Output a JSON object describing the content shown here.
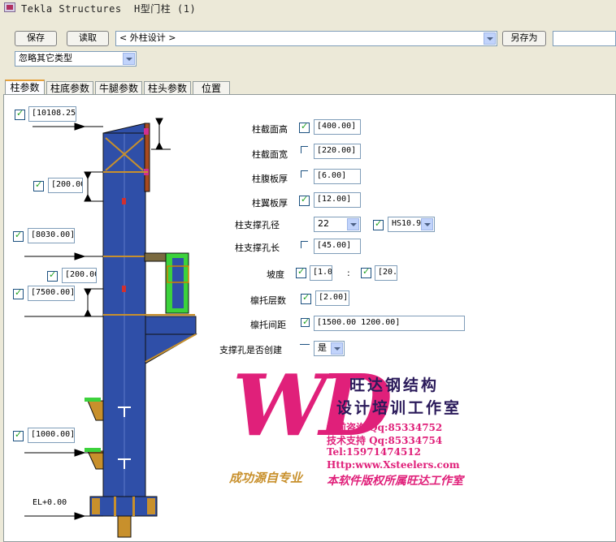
{
  "window": {
    "title": "Tekla Structures  H型门柱 (1)"
  },
  "toolbar": {
    "save_label": "保存",
    "load_label": "读取",
    "preset_value": "< 外柱设计 >",
    "saveas_label": "另存为",
    "saveas_value": "",
    "filter_value": "忽略其它类型"
  },
  "tabs": [
    "柱参数",
    "柱底参数",
    "牛腿参数",
    "柱头参数",
    "位置"
  ],
  "drawing": {
    "dim_top": "[10108.25",
    "dim_2": "[200.00",
    "dim_3": "[8030.00]",
    "dim_4": "[200.00",
    "dim_5": "[7500.00]",
    "dim_6": "[1000.00]",
    "elevation": "EL+0.00"
  },
  "params": {
    "section_height": {
      "label": "柱截面高",
      "value": "[400.00]",
      "checked": true
    },
    "section_width": {
      "label": "柱截面宽",
      "value": "[220.00]",
      "checked": false
    },
    "web_thickness": {
      "label": "柱腹板厚",
      "value": "[6.00]",
      "checked": false
    },
    "flange_thickness": {
      "label": "柱翼板厚",
      "value": "[12.00]",
      "checked": true
    },
    "brace_hole_dia": {
      "label": "柱支撑孔径",
      "value": "22",
      "checked": true,
      "bolt": "HS10.9"
    },
    "brace_hole_len": {
      "label": "柱支撑孔长",
      "value": "[45.00]",
      "checked": false
    },
    "slope": {
      "label": "坡度",
      "value1": "[1.0",
      "sep": ":",
      "value2": "[20."
    },
    "bracket_layers": {
      "label": "檩托层数",
      "value": "[2.00]",
      "checked": true
    },
    "bracket_spacing": {
      "label": "檩托间距",
      "value": "[1500.00 1200.00]"
    },
    "create_brace_holes": {
      "label": "支撑孔是否创建",
      "value": "是"
    }
  },
  "watermark": {
    "logo": "WD",
    "company": "旺达钢结构",
    "studio": "设计培训工作室",
    "presales": "售前咨询 Qq:85334752",
    "support": "技术支持 Qq:85334754",
    "tel": "Tel:15971474512",
    "url": "Http:www.Xsteelers.com",
    "slogan": "成功源自专业",
    "copyright": "本软件版权所属旺达工作室"
  },
  "colors": {
    "column_blue": "#2f4fa8",
    "steel_orange": "#c8902c",
    "accent_green": "#3cd23c",
    "watermark_red": "#e0207a"
  }
}
